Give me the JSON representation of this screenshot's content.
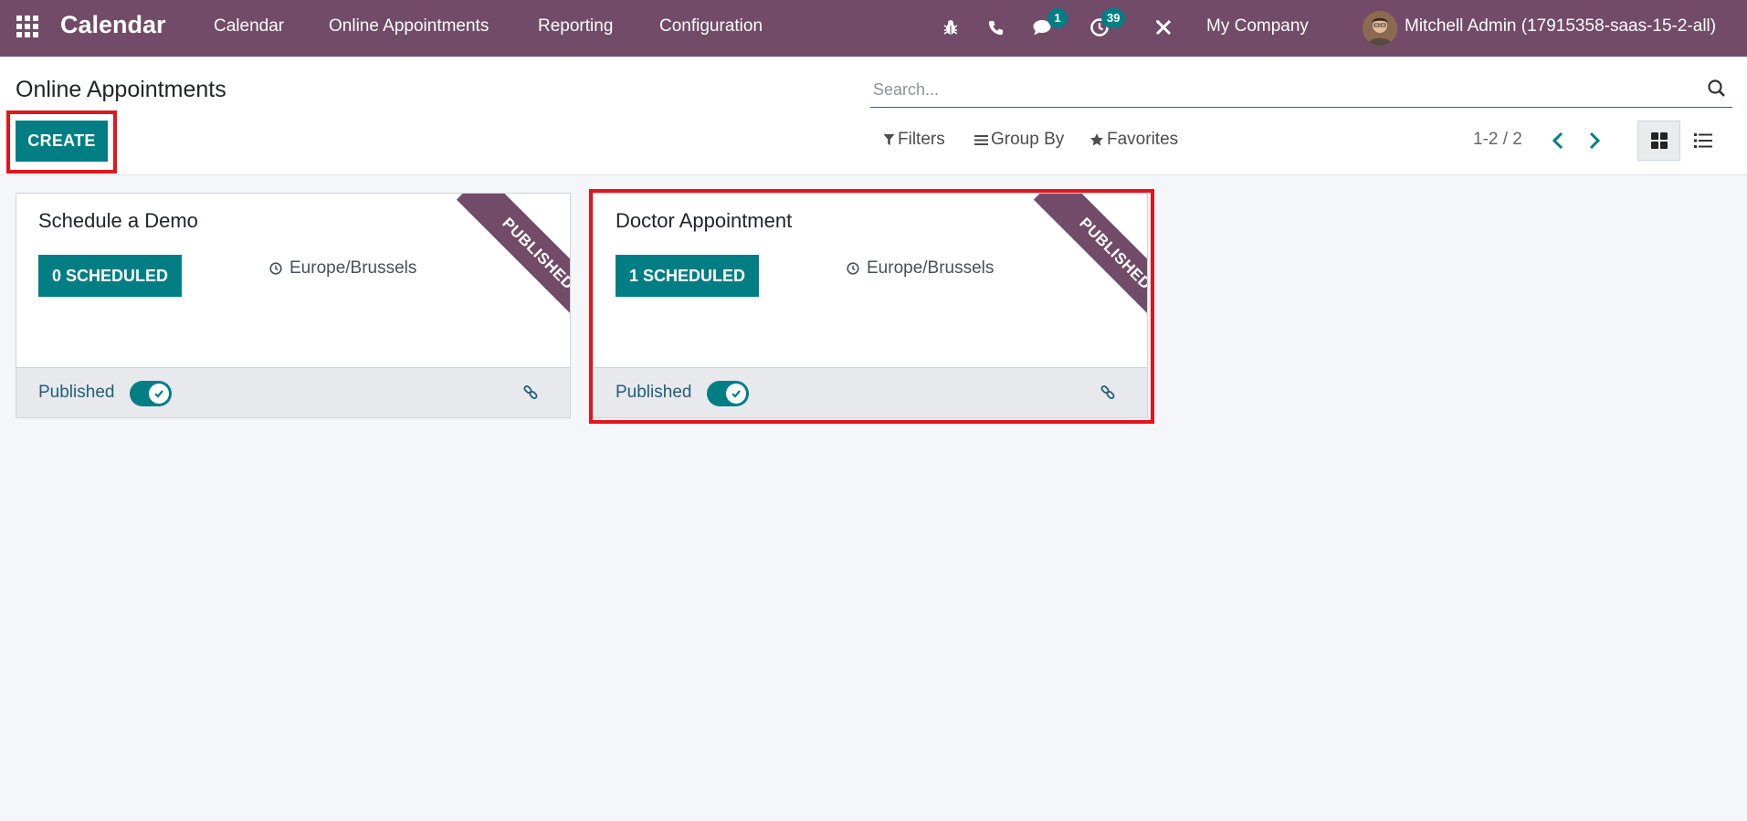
{
  "navbar": {
    "app_name": "Calendar",
    "menu": [
      "Calendar",
      "Online Appointments",
      "Reporting",
      "Configuration"
    ],
    "messages_count": "1",
    "activities_count": "39",
    "company": "My Company",
    "user": "Mitchell Admin (17915358-saas-15-2-all)"
  },
  "control_panel": {
    "title": "Online Appointments",
    "create_label": "CREATE",
    "search_placeholder": "Search...",
    "filters_label": "Filters",
    "group_by_label": "Group By",
    "favorites_label": "Favorites",
    "pager": "1-2 / 2"
  },
  "cards": [
    {
      "title": "Schedule a Demo",
      "scheduled": "0 SCHEDULED",
      "timezone": "Europe/Brussels",
      "ribbon": "PUBLISHED",
      "published_label": "Published",
      "published": true
    },
    {
      "title": "Doctor Appointment",
      "scheduled": "1 SCHEDULED",
      "timezone": "Europe/Brussels",
      "ribbon": "PUBLISHED",
      "published_label": "Published",
      "published": true
    }
  ],
  "colors": {
    "brand": "#714b67",
    "accent": "#017e84",
    "highlight": "#e3151c"
  }
}
